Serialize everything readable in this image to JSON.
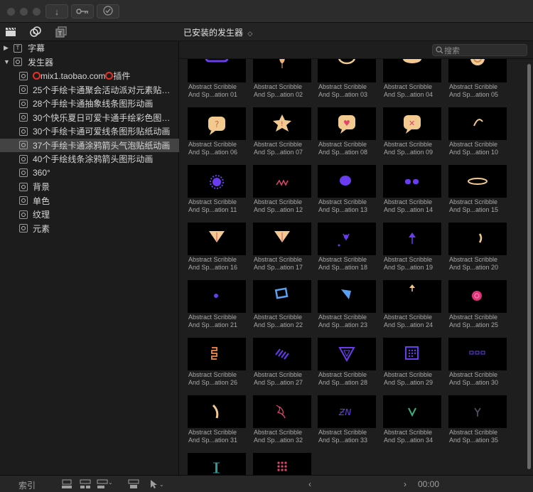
{
  "titlebar": {
    "buttons": [
      {
        "icon": "download-icon",
        "glyph": "↓"
      },
      {
        "icon": "key-icon",
        "glyph": "⚷"
      },
      {
        "icon": "checkmark-icon",
        "glyph": "✓"
      }
    ]
  },
  "toolbar": {
    "title": "已安装的发生器",
    "title_arrow": "◇"
  },
  "sidebar": {
    "items": [
      {
        "label": "字幕",
        "level": 0,
        "expanded": false,
        "icon": "T",
        "selected": false
      },
      {
        "label": "发生器",
        "level": 0,
        "expanded": true,
        "icon": "ring",
        "selected": false
      },
      {
        "label": "mix1.taobao.com",
        "suffix": "插件",
        "level": 1,
        "icon": "ring",
        "circles": true,
        "selected": false
      },
      {
        "label": "25个手绘卡通聚会活动派对元素贴纸…",
        "level": 1,
        "icon": "ring",
        "selected": false
      },
      {
        "label": "28个手绘卡通抽象线条图形动画",
        "level": 1,
        "icon": "ring",
        "selected": false
      },
      {
        "label": "30个快乐夏日可爱卡通手绘彩色图形…",
        "level": 1,
        "icon": "ring",
        "selected": false
      },
      {
        "label": "30个手绘卡通可爱线条图形贴纸动画",
        "level": 1,
        "icon": "ring",
        "selected": false
      },
      {
        "label": "37个手绘卡通涂鸦箭头气泡贴纸动画",
        "level": 1,
        "icon": "ring",
        "selected": true
      },
      {
        "label": "40个手绘线条涂鸦箭头图形动画",
        "level": 1,
        "icon": "ring",
        "selected": false
      },
      {
        "label": "360°",
        "level": 1,
        "icon": "ring",
        "selected": false
      },
      {
        "label": "背景",
        "level": 1,
        "icon": "ring",
        "selected": false
      },
      {
        "label": "单色",
        "level": 1,
        "icon": "ring",
        "selected": false
      },
      {
        "label": "纹理",
        "level": 1,
        "icon": "ring",
        "selected": false
      },
      {
        "label": "元素",
        "level": 1,
        "icon": "ring",
        "selected": false
      }
    ]
  },
  "browser": {
    "search_placeholder": "搜索",
    "tiles": [
      {
        "line1": "Abstract Scribble",
        "line2": "And Sp...ation 01",
        "shape": "pill",
        "color": "#6a3cf0"
      },
      {
        "line1": "Abstract Scribble",
        "line2": "And Sp...ation 02",
        "shape": "balloon",
        "color": "#f0b37e"
      },
      {
        "line1": "Abstract Scribble",
        "line2": "And Sp...ation 03",
        "shape": "bubble",
        "color": "#f2c98e"
      },
      {
        "line1": "Abstract Scribble",
        "line2": "And Sp...ation 04",
        "shape": "cloud",
        "color": "#f2c98e"
      },
      {
        "line1": "Abstract Scribble",
        "line2": "And Sp...ation 05",
        "shape": "coin",
        "color": "#f2c98e"
      },
      {
        "line1": "Abstract Scribble",
        "line2": "And Sp...ation 06",
        "shape": "bubble-q",
        "color": "#f2c98e"
      },
      {
        "line1": "Abstract Scribble",
        "line2": "And Sp...ation 07",
        "shape": "star-burst",
        "color": "#f2c98e"
      },
      {
        "line1": "Abstract Scribble",
        "line2": "And Sp...ation 08",
        "shape": "bubble-heart",
        "color": "#f2c98e"
      },
      {
        "line1": "Abstract Scribble",
        "line2": "And Sp...ation 09",
        "shape": "bubble-x",
        "color": "#f2c98e"
      },
      {
        "line1": "Abstract Scribble",
        "line2": "And Sp...ation 10",
        "shape": "arc",
        "color": "#f2c98e"
      },
      {
        "line1": "Abstract Scribble",
        "line2": "And Sp...ation 11",
        "shape": "gear",
        "color": "#6a3cf0"
      },
      {
        "line1": "Abstract Scribble",
        "line2": "And Sp...ation 12",
        "shape": "scribble",
        "color": "#e0466a"
      },
      {
        "line1": "Abstract Scribble",
        "line2": "And Sp...ation 13",
        "shape": "blob",
        "color": "#6a3cf0"
      },
      {
        "line1": "Abstract Scribble",
        "line2": "And Sp...ation 14",
        "shape": "dots2",
        "color": "#6a3cf0"
      },
      {
        "line1": "Abstract Scribble",
        "line2": "And Sp...ation 15",
        "shape": "halo",
        "color": "#f2c98e"
      },
      {
        "line1": "Abstract Scribble",
        "line2": "And Sp...ation 16",
        "shape": "tri-down",
        "color": "#f2c98e"
      },
      {
        "line1": "Abstract Scribble",
        "line2": "And Sp...ation 17",
        "shape": "tri-down",
        "color": "#f2c98e"
      },
      {
        "line1": "Abstract Scribble",
        "line2": "And Sp...ation 18",
        "shape": "splat",
        "color": "#6a3cf0"
      },
      {
        "line1": "Abstract Scribble",
        "line2": "And Sp...ation 19",
        "shape": "arrow-up",
        "color": "#6a3cf0"
      },
      {
        "line1": "Abstract Scribble",
        "line2": "And Sp...ation 20",
        "shape": "hook",
        "color": "#f2c98e"
      },
      {
        "line1": "Abstract Scribble",
        "line2": "And Sp...ation 21",
        "shape": "dot",
        "color": "#6a3cf0"
      },
      {
        "line1": "Abstract Scribble",
        "line2": "And Sp...ation 22",
        "shape": "tag",
        "color": "#5aa0f0"
      },
      {
        "line1": "Abstract Scribble",
        "line2": "And Sp...ation 23",
        "shape": "shard",
        "color": "#5aa0f0"
      },
      {
        "line1": "Abstract Scribble",
        "line2": "And Sp...ation 24",
        "shape": "arrow-up-small",
        "color": "#f2c98e"
      },
      {
        "line1": "Abstract Scribble",
        "line2": "And Sp...ation 25",
        "shape": "spiral",
        "color": "#e0327a"
      },
      {
        "line1": "Abstract Scribble",
        "line2": "And Sp...ation 26",
        "shape": "zigzag",
        "color": "#e07a3a"
      },
      {
        "line1": "Abstract Scribble",
        "line2": "And Sp...ation 27",
        "shape": "hatch",
        "color": "#6a3cf0"
      },
      {
        "line1": "Abstract Scribble",
        "line2": "And Sp...ation 28",
        "shape": "tri-outline",
        "color": "#6a3cf0"
      },
      {
        "line1": "Abstract Scribble",
        "line2": "And Sp...ation 29",
        "shape": "grid-box",
        "color": "#6a3cf0"
      },
      {
        "line1": "Abstract Scribble",
        "line2": "And Sp...ation 30",
        "shape": "dashes",
        "color": "#6a3cf0"
      },
      {
        "line1": "Abstract Scribble",
        "line2": "And Sp...ation 31",
        "shape": "stroke",
        "color": "#f2c98e"
      },
      {
        "line1": "Abstract Scribble",
        "line2": "And Sp...ation 32",
        "shape": "scribble2",
        "color": "#e0466a"
      },
      {
        "line1": "Abstract Scribble",
        "line2": "And Sp...ation 33",
        "shape": "zn",
        "color": "#6a3cf0"
      },
      {
        "line1": "Abstract Scribble",
        "line2": "And Sp...ation 34",
        "shape": "v-green",
        "color": "#3ab07a"
      },
      {
        "line1": "Abstract Scribble",
        "line2": "And Sp...ation 35",
        "shape": "y-dark",
        "color": "#5a5a6a"
      },
      {
        "line1": "",
        "line2": "",
        "shape": "bar-teal",
        "color": "#2a9a9a"
      },
      {
        "line1": "",
        "line2": "",
        "shape": "pink-grid",
        "color": "#e0466a"
      }
    ]
  },
  "bottombar": {
    "index_label": "索引",
    "timecode": "00:00"
  }
}
